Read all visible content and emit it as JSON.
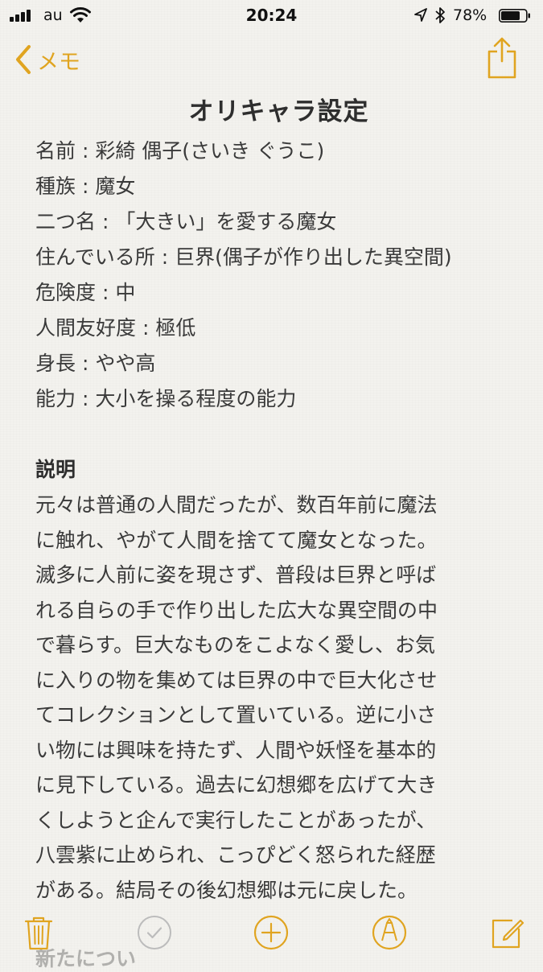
{
  "status_bar": {
    "carrier": "au",
    "time": "20:24",
    "battery": "78%",
    "battery_level": 0.78,
    "icons": [
      "signal-icon",
      "wifi-icon",
      "location-icon",
      "bluetooth-icon",
      "battery-icon"
    ]
  },
  "nav": {
    "back_label": "メモ",
    "back_icon": "chevron-left-icon",
    "share_icon": "share-icon"
  },
  "note": {
    "title": "オリキャラ設定",
    "fields": [
      "名前 : 彩綺 偶子(さいき ぐうこ)",
      "種族 : 魔女",
      "二つ名 : 「大きい」を愛する魔女",
      "住んでいる所 : 巨界(偶子が作り出した異空間)",
      "危険度 : 中",
      "人間友好度 : 極低",
      "身長 : やや高",
      "能力 : 大小を操る程度の能力"
    ],
    "section_heading": "説明",
    "description_lines": [
      "元々は普通の人間だったが、数百年前に魔法",
      "に触れ、やがて人間を捨てて魔女となった。",
      "滅多に人前に姿を現さず、普段は巨界と呼ば",
      "れる自らの手で作り出した広大な異空間の中",
      "で暮らす。巨大なものをこよなく愛し、お気",
      "に入りの物を集めては巨界の中で巨大化させ",
      "てコレクションとして置いている。逆に小さ",
      "い物には興味を持たず、人間や妖怪を基本的",
      "に見下している。過去に幻想郷を広げて大き",
      "くしようと企んで実行したことがあったが、",
      "八雲紫に止められ、こっぴどく怒られた経歴",
      "がある。結局その後幻想郷は元に戻した。"
    ],
    "next_section_partial": "新たについ"
  },
  "toolbar": {
    "icons": [
      "trash-icon",
      "checklist-icon",
      "add-icon",
      "markup-icon",
      "compose-icon"
    ]
  },
  "colors": {
    "accent": "#e0a420",
    "text": "#3a3a3a",
    "background": "#f3f2ee"
  }
}
